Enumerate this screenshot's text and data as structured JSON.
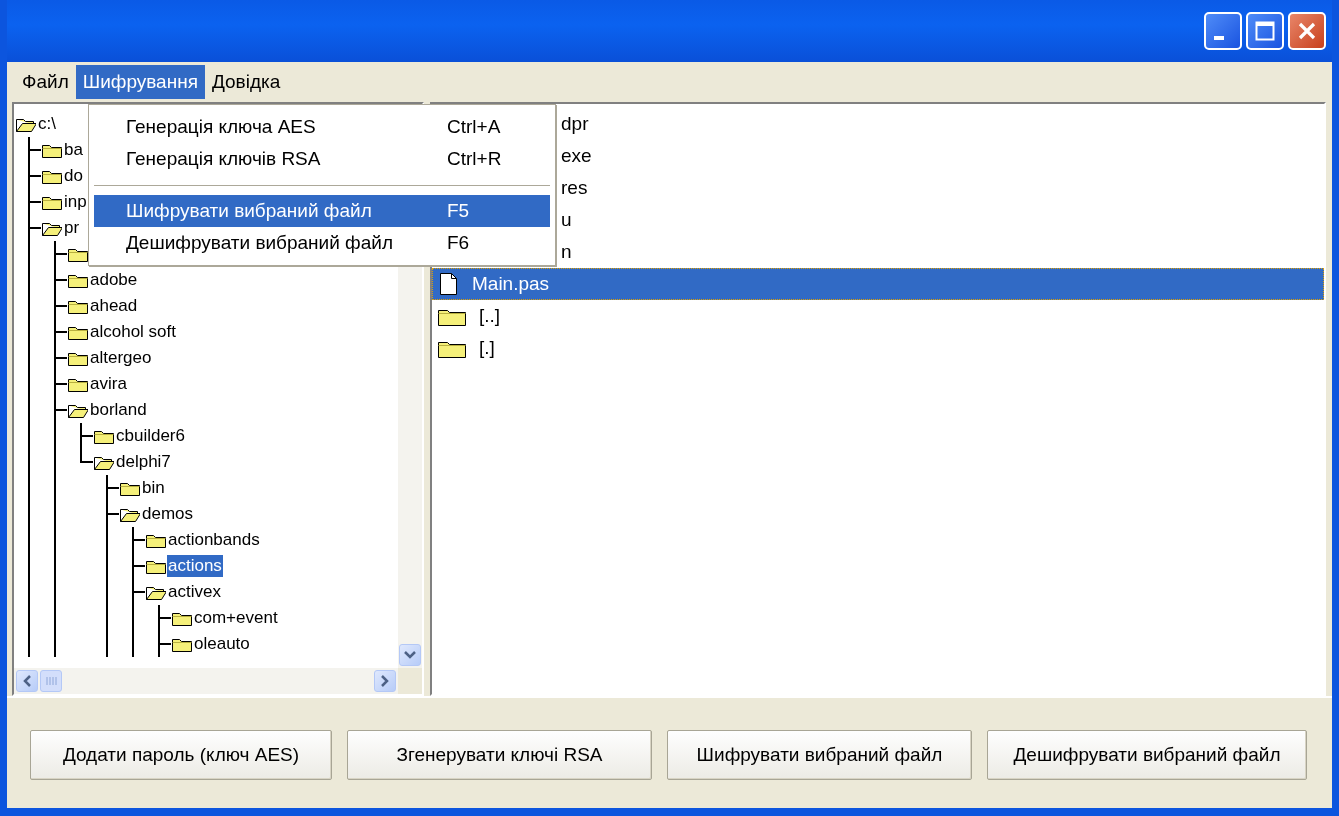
{
  "menu_bar": [
    {
      "label": "Файл",
      "selected": false
    },
    {
      "label": "Шифрування",
      "selected": true
    },
    {
      "label": "Довідка",
      "selected": false
    }
  ],
  "dropdown": [
    {
      "kind": "item",
      "label": "Генерація ключа AES",
      "shortcut": "Ctrl+A",
      "selected": false
    },
    {
      "kind": "item",
      "label": "Генерація ключів RSA",
      "shortcut": "Ctrl+R",
      "selected": false
    },
    {
      "kind": "separator"
    },
    {
      "kind": "item",
      "label": "Шифрувати вибраний файл",
      "shortcut": "F5",
      "selected": true
    },
    {
      "kind": "item",
      "label": "Дешифрувати вибраний файл",
      "shortcut": "F6",
      "selected": false
    }
  ],
  "tree": [
    {
      "label": "c:\\",
      "expanded": true,
      "more_below": true,
      "selected": false,
      "children": [
        {
          "label": "ba",
          "expanded": false,
          "selected": false
        },
        {
          "label": "do",
          "expanded": false,
          "selected": false
        },
        {
          "label": "inp",
          "expanded": false,
          "selected": false
        },
        {
          "label": "pr",
          "expanded": true,
          "more_below": true,
          "selected": false,
          "children": [
            {
              "expanded": false
            },
            {
              "label": "adobe",
              "expanded": false,
              "selected": false
            },
            {
              "label": "ahead",
              "expanded": false,
              "selected": false
            },
            {
              "label": "alcohol soft",
              "expanded": false,
              "selected": false
            },
            {
              "label": "altergeo",
              "expanded": false,
              "selected": false
            },
            {
              "label": "avira",
              "expanded": false,
              "selected": false
            },
            {
              "label": "borland",
              "expanded": true,
              "more_below": false,
              "selected": false,
              "children": [
                {
                  "label": "cbuilder6",
                  "expanded": false,
                  "selected": false
                },
                {
                  "label": "delphi7",
                  "expanded": true,
                  "more_below": true,
                  "selected": false,
                  "children": [
                    {
                      "label": "bin",
                      "expanded": false,
                      "selected": false
                    },
                    {
                      "label": "demos",
                      "expanded": true,
                      "more_below": true,
                      "selected": false,
                      "children": [
                        {
                          "label": "actionbands",
                          "expanded": false,
                          "selected": false
                        },
                        {
                          "label": "actions",
                          "expanded": false,
                          "selected": true
                        },
                        {
                          "label": "activex",
                          "expanded": true,
                          "more_below": true,
                          "selected": false,
                          "children": [
                            {
                              "label": "com+event",
                              "expanded": false,
                              "selected": false
                            },
                            {
                              "label": "oleauto",
                              "expanded": false,
                              "selected": false
                            }
                          ]
                        }
                      ]
                    }
                  ]
                }
              ]
            }
          ]
        }
      ]
    }
  ],
  "file_list": [
    {
      "kind": "partial",
      "label": "dpr",
      "selected": false
    },
    {
      "kind": "partial",
      "label": "exe",
      "selected": false
    },
    {
      "kind": "partial",
      "label": "res",
      "selected": false
    },
    {
      "kind": "partial",
      "label": "u",
      "selected": false
    },
    {
      "kind": "partial",
      "label": "n",
      "selected": false
    },
    {
      "kind": "file",
      "label": "Main.pas",
      "selected": true
    },
    {
      "kind": "folder",
      "label": "[..]",
      "selected": false
    },
    {
      "kind": "folder",
      "label": "[.]",
      "selected": false
    }
  ],
  "buttons": [
    "Додати пароль (ключ AES)",
    "Згенерувати ключі RSA",
    "Шифрувати вибраний файл",
    "Дешифрувати вибраний файл"
  ]
}
